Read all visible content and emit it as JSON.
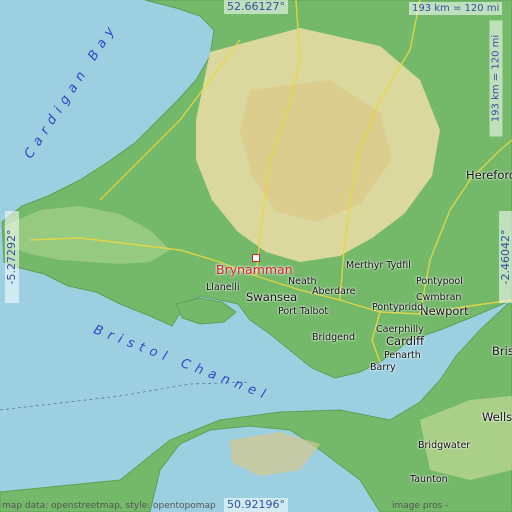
{
  "map": {
    "center_place": "Brynamman",
    "bounds": {
      "north_label": "52.66127°",
      "south_label": "50.92196°",
      "west_label": "-5.27292°",
      "east_label": "-2.46042°"
    },
    "scale_label": "193 km = 120 mi",
    "seas": {
      "cardigan": "Cardigan Bay",
      "bristol": "Bristol Channel"
    },
    "cities": {
      "llanelli": "Llanelli",
      "swansea": "Swansea",
      "neath": "Neath",
      "aberdare": "Aberdare",
      "merthyr": "Merthyr Tydfil",
      "pontypool": "Pontypool",
      "cwmbran": "Cwmbran",
      "newport": "Newport",
      "pontypridd": "Pontypridd",
      "port_talbot": "Port Talbot",
      "caerphilly": "Caerphilly",
      "bridgend": "Bridgend",
      "cardiff": "Cardiff",
      "penarth": "Penarth",
      "barry": "Barry",
      "hereford": "Hereford",
      "bristol": "Bristol",
      "wells": "Wells",
      "bridgwater": "Bridgwater",
      "taunton": "Taunton"
    },
    "attribution_left": "map data: openstreetmap, style: opentopomap",
    "attribution_right": "image pros - elevation.city",
    "colors": {
      "sea": "#9cd0e0",
      "lowland": "#74b86a",
      "upland": "#e6dba2",
      "marker": "#d8202a",
      "coord_text": "#2f52a0"
    }
  }
}
